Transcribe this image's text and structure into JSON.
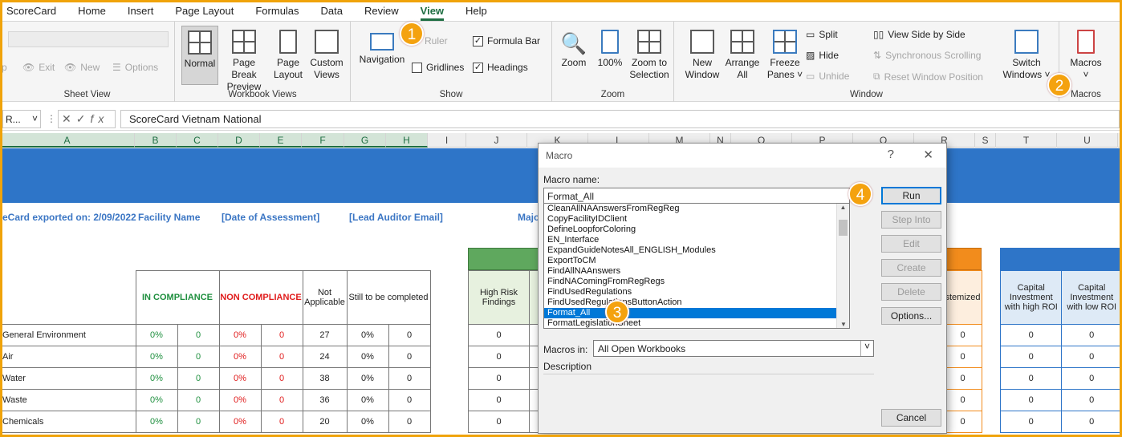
{
  "tabs": [
    "ScoreCard",
    "Home",
    "Insert",
    "Page Layout",
    "Formulas",
    "Data",
    "Review",
    "View",
    "Help"
  ],
  "active_tab": "View",
  "sheet_view": {
    "label": "Sheet View",
    "exit": "Exit",
    "new": "New",
    "options": "Options",
    "keep": "p"
  },
  "workbook_views": {
    "label": "Workbook Views",
    "normal": "Normal",
    "page_break": [
      "Page Break",
      "Preview"
    ],
    "page_layout": [
      "Page",
      "Layout"
    ],
    "custom": [
      "Custom",
      "Views"
    ]
  },
  "show": {
    "label": "Show",
    "navigation": "Navigation",
    "ruler": "Ruler",
    "formula_bar": "Formula Bar",
    "gridlines": "Gridlines",
    "headings": "Headings"
  },
  "zoom": {
    "label": "Zoom",
    "zoom": "Zoom",
    "hundred": "100%",
    "selection": [
      "Zoom to",
      "Selection"
    ]
  },
  "window": {
    "label": "Window",
    "new": [
      "New",
      "Window"
    ],
    "arrange": [
      "Arrange",
      "All"
    ],
    "freeze": [
      "Freeze",
      "Panes"
    ],
    "split": "Split",
    "hide": "Hide",
    "unhide": "Unhide",
    "side_by_side": "View Side by Side",
    "sync": "Synchronous Scrolling",
    "reset": "Reset Window Position",
    "switch": [
      "Switch",
      "Windows"
    ]
  },
  "macros": {
    "label": "Macros",
    "button": "Macros"
  },
  "formula_bar": {
    "name_box": "R...",
    "content": "ScoreCard Vietnam National"
  },
  "columns": [
    "A",
    "B",
    "C",
    "D",
    "E",
    "F",
    "G",
    "H",
    "I",
    "J",
    "K",
    "L",
    "M",
    "N",
    "O",
    "P",
    "Q",
    "R",
    "S",
    "T",
    "U"
  ],
  "sheet": {
    "exported": "eCard exported on: 2/09/2022",
    "facility": "Facility Name",
    "date": "[Date of Assessment]",
    "auditor": "[Lead Auditor Email]",
    "major": "Majo",
    "in_compliance": "IN COMPLIANCE",
    "non_compliance": "NON COMPLIANCE",
    "not_applicable": "Not Applicable",
    "still": "Still to be completed",
    "high_risk": "High Risk Findings",
    "stemized": "stemized",
    "capital_high": "Capital Investment with high ROI",
    "capital_low": "Capital Investment with low ROI",
    "rows": [
      {
        "name": "General Environment",
        "pct": "0%",
        "c": "0",
        "pct2": "0%",
        "e": "0",
        "na": "27",
        "g": "0%",
        "h": "0"
      },
      {
        "name": "Air",
        "pct": "0%",
        "c": "0",
        "pct2": "0%",
        "e": "0",
        "na": "24",
        "g": "0%",
        "h": "0"
      },
      {
        "name": "Water",
        "pct": "0%",
        "c": "0",
        "pct2": "0%",
        "e": "0",
        "na": "38",
        "g": "0%",
        "h": "0"
      },
      {
        "name": "Waste",
        "pct": "0%",
        "c": "0",
        "pct2": "0%",
        "e": "0",
        "na": "36",
        "g": "0%",
        "h": "0"
      },
      {
        "name": "Chemicals",
        "pct": "0%",
        "c": "0",
        "pct2": "0%",
        "e": "0",
        "na": "20",
        "g": "0%",
        "h": "0"
      }
    ],
    "zero": "0"
  },
  "dialog": {
    "title": "Macro",
    "help": "?",
    "close": "✕",
    "macro_name_label": "Macro name:",
    "macro_name_value": "Format_All",
    "macro_list": [
      "CleanAllNAAnswersFromRegReg",
      "CopyFacilityIDClient",
      "DefineLoopforColoring",
      "EN_Interface",
      "ExpandGuideNotesAll_ENGLISH_Modules",
      "ExportToCM",
      "FindAllNAAnswers",
      "FindNAComingFromRegRegs",
      "FindUsedRegulations",
      "FindUsedRegulationsButtonAction",
      "Format_All",
      "FormatLegislationSheet"
    ],
    "selected": "Format_All",
    "buttons": {
      "run": "Run",
      "step": "Step Into",
      "edit": "Edit",
      "create": "Create",
      "delete": "Delete",
      "options": "Options...",
      "cancel": "Cancel"
    },
    "macros_in_label": "Macros in:",
    "macros_in_value": "All Open Workbooks",
    "description_label": "Description"
  },
  "badges": [
    "1",
    "2",
    "3",
    "4"
  ]
}
